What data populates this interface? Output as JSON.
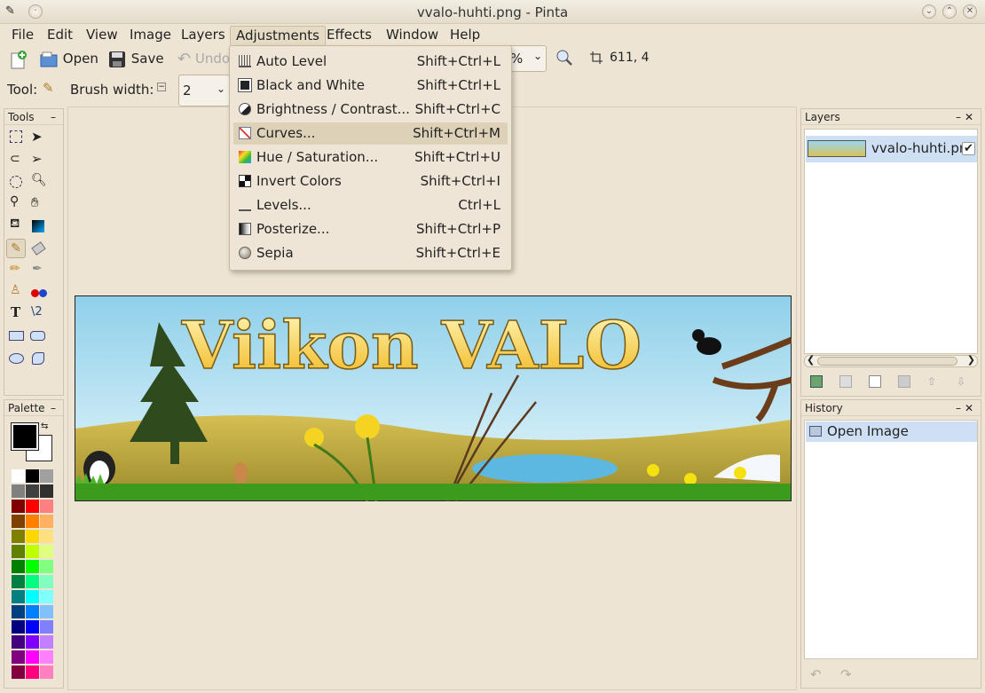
{
  "window": {
    "title": "vvalo-huhti.png - Pinta"
  },
  "menubar": {
    "items": [
      {
        "label": "File"
      },
      {
        "label": "Edit"
      },
      {
        "label": "View"
      },
      {
        "label": "Image"
      },
      {
        "label": "Layers"
      },
      {
        "label": "Adjustments"
      },
      {
        "label": "Effects"
      },
      {
        "label": "Window"
      },
      {
        "label": "Help"
      }
    ]
  },
  "toolbar": {
    "open_label": "Open",
    "save_label": "Save",
    "undo_label": "Undo",
    "zoom_value": "%",
    "cursor_position": "611, 4"
  },
  "toolbar2": {
    "tool_label": "Tool:",
    "brush_width_label": "Brush width:",
    "brush_width_value": "2"
  },
  "adjustments_menu": {
    "items": [
      {
        "label": "Auto Level",
        "shortcut": "Shift+Ctrl+L",
        "icon": "auto-level-icon"
      },
      {
        "label": "Black and White",
        "shortcut": "Shift+Ctrl+L",
        "icon": "black-white-icon"
      },
      {
        "label": "Brightness / Contrast...",
        "shortcut": "Shift+Ctrl+C",
        "icon": "brightness-icon"
      },
      {
        "label": "Curves...",
        "shortcut": "Shift+Ctrl+M",
        "icon": "curves-icon"
      },
      {
        "label": "Hue / Saturation...",
        "shortcut": "Shift+Ctrl+U",
        "icon": "hue-icon"
      },
      {
        "label": "Invert Colors",
        "shortcut": "Shift+Ctrl+I",
        "icon": "invert-icon"
      },
      {
        "label": "Levels...",
        "shortcut": "Ctrl+L",
        "icon": "levels-icon"
      },
      {
        "label": "Posterize...",
        "shortcut": "Shift+Ctrl+P",
        "icon": "posterize-icon"
      },
      {
        "label": "Sepia",
        "shortcut": "Shift+Ctrl+E",
        "icon": "sepia-icon"
      }
    ]
  },
  "tools_panel": {
    "title": "Tools"
  },
  "palette_panel": {
    "title": "Palette",
    "primary_color": "#000000",
    "secondary_color": "#ffffff",
    "colors": [
      "#ffffff",
      "#000000",
      "#a0a0a0",
      "#808080",
      "#404040",
      "#303030",
      "#800000",
      "#ff0000",
      "#ff8080",
      "#804000",
      "#ff8000",
      "#ffb060",
      "#808000",
      "#ffd700",
      "#ffe080",
      "#608000",
      "#c0ff00",
      "#e0ff80",
      "#008000",
      "#00ff00",
      "#80ff80",
      "#008040",
      "#00ff80",
      "#80ffc0",
      "#008080",
      "#00ffff",
      "#80ffff",
      "#004080",
      "#0080ff",
      "#80c0ff",
      "#000080",
      "#0000ff",
      "#8080ff",
      "#400080",
      "#8000ff",
      "#c080ff",
      "#800080",
      "#ff00ff",
      "#ff80ff",
      "#800040",
      "#ff0080",
      "#ff80c0"
    ]
  },
  "layers_panel": {
    "title": "Layers",
    "layers": [
      {
        "name": "vvalo-huhti.pr",
        "visible": true
      }
    ]
  },
  "history_panel": {
    "title": "History",
    "items": [
      {
        "label": "Open Image"
      }
    ]
  },
  "canvas": {
    "banner_text": "Viikon VALO"
  }
}
